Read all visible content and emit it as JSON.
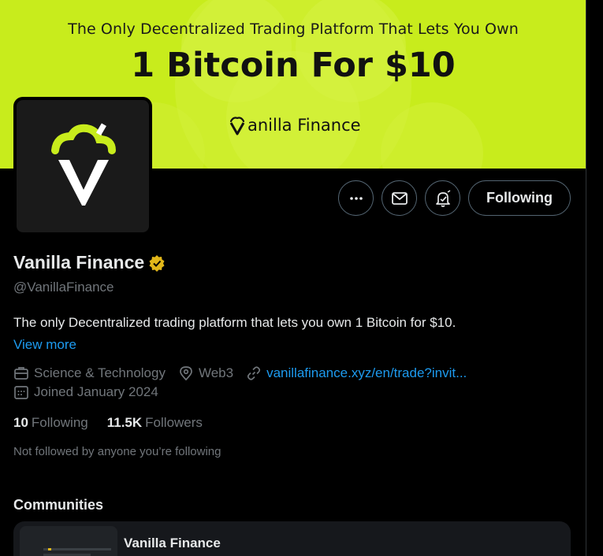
{
  "banner": {
    "tagline": "The Only Decentralized Trading Platform That Lets You Own",
    "headline": "1 Bitcoin For $10",
    "brand_text": "anilla Finance",
    "background_color": "#c8ec1c"
  },
  "profile": {
    "display_name": "Vanilla Finance",
    "verified_badge_icon": "verified-gold-icon",
    "handle": "@VanillaFinance",
    "bio": "The only Decentralized trading platform that lets you own 1 Bitcoin for $10.",
    "view_more": "View more",
    "category": "Science & Technology",
    "location": "Web3",
    "website": "vanillafinance.xyz/en/trade?invit...",
    "joined": "Joined January 2024",
    "following_count": "10",
    "following_label": "Following",
    "followers_count": "11.5K",
    "followers_label": "Followers",
    "not_followed": "Not followed by anyone you’re following"
  },
  "actions": {
    "more_icon": "more-icon",
    "message_icon": "message-icon",
    "notify_icon": "bell-icon",
    "follow_label": "Following"
  },
  "communities": {
    "title": "Communities",
    "items": [
      {
        "name": "Vanilla Finance"
      }
    ]
  },
  "colors": {
    "accent": "#1d9bf0",
    "muted": "#71767b",
    "text": "#e7e9ea",
    "brand_lime": "#c8ec1c"
  }
}
